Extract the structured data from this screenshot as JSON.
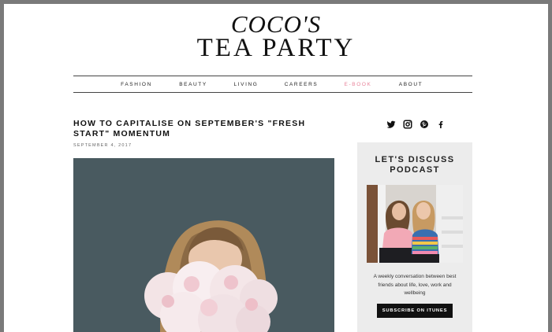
{
  "site": {
    "logo_line1": "COCO'S",
    "logo_line2": "TEA PARTY"
  },
  "nav": {
    "items": [
      {
        "label": "FASHION"
      },
      {
        "label": "BEAUTY"
      },
      {
        "label": "LIVING"
      },
      {
        "label": "CAREERS"
      },
      {
        "label": "E-BOOK",
        "active": true
      },
      {
        "label": "ABOUT"
      }
    ],
    "active_color": "#e8839a"
  },
  "post": {
    "title": "HOW TO CAPITALISE ON SEPTEMBER'S \"FRESH START\" MOMENTUM",
    "date": "SEPTEMBER 4, 2017"
  },
  "social": [
    "twitter-icon",
    "instagram-icon",
    "pinterest-icon",
    "facebook-icon"
  ],
  "sidebar": {
    "title": "LET'S DISCUSS PODCAST",
    "description": "A weekly conversation between best friends about life, love, work and wellbeing",
    "button_label": "SUBSCRIBE ON ITUNES"
  },
  "colors": {
    "frame": "#7a7a7a",
    "hero_background": "#495a60",
    "sidebar_background": "#ececec",
    "button": "#111111"
  }
}
